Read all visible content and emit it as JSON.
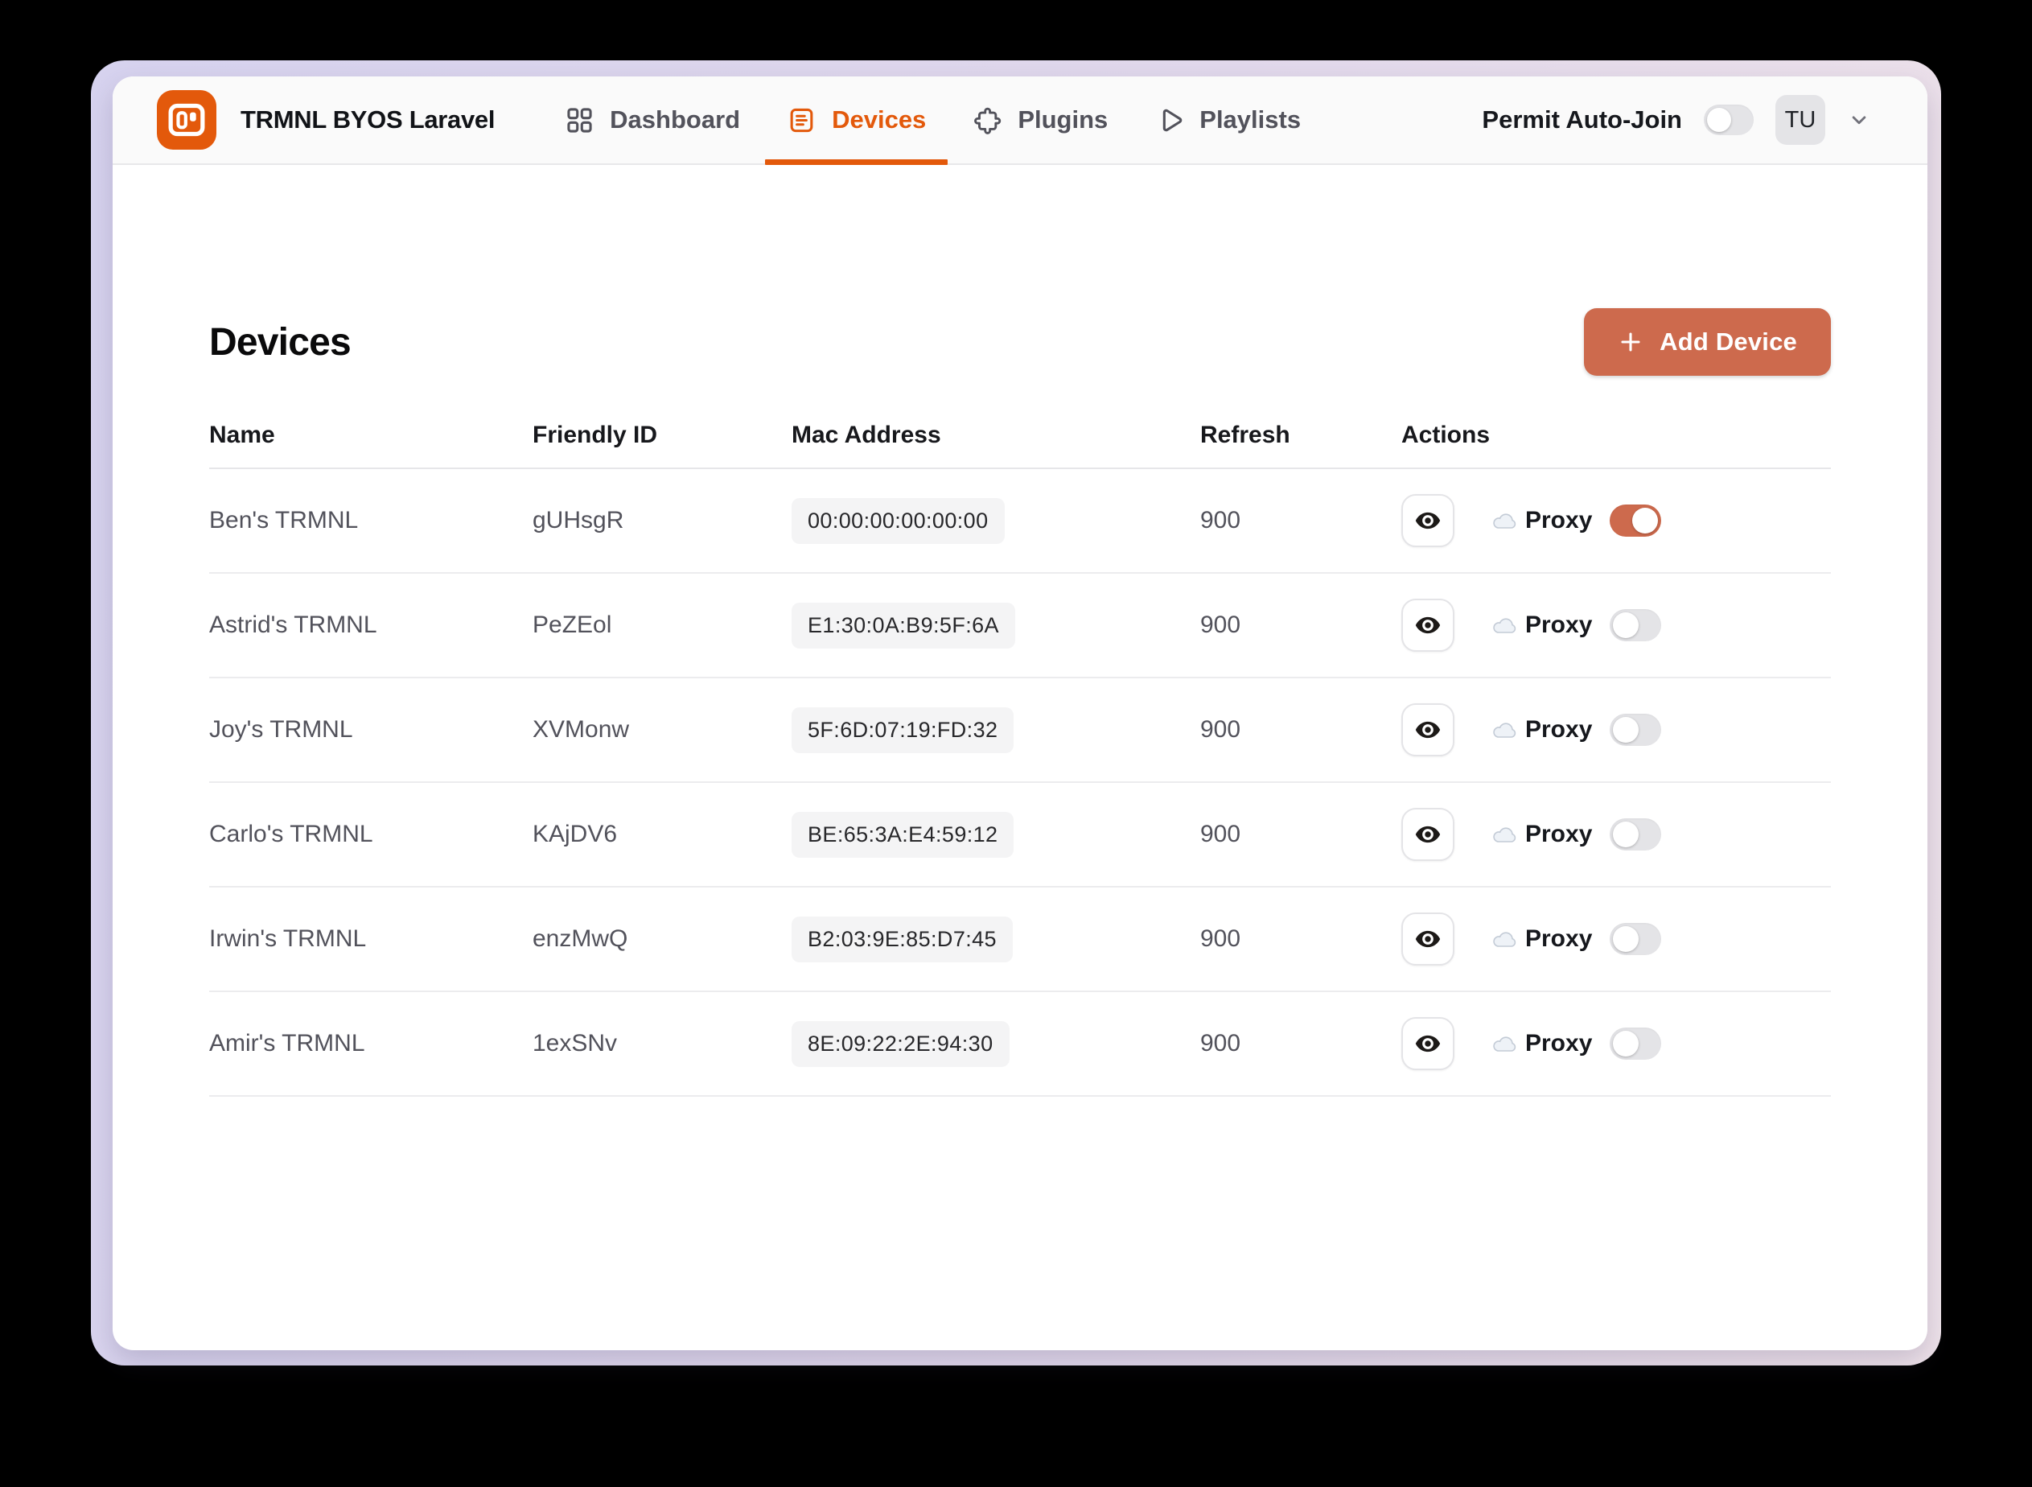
{
  "app": {
    "title": "TRMNL BYOS Laravel"
  },
  "nav": {
    "items": [
      {
        "label": "Dashboard",
        "icon": "grid-icon",
        "active": false
      },
      {
        "label": "Devices",
        "icon": "list-icon",
        "active": true
      },
      {
        "label": "Plugins",
        "icon": "puzzle-icon",
        "active": false
      },
      {
        "label": "Playlists",
        "icon": "play-icon",
        "active": false
      }
    ]
  },
  "header_right": {
    "auto_join_label": "Permit Auto-Join",
    "auto_join_on": false,
    "avatar_initials": "TU"
  },
  "page": {
    "title": "Devices",
    "add_button_label": "Add Device",
    "add_button_icon": "plus-icon"
  },
  "table": {
    "columns": [
      "Name",
      "Friendly ID",
      "Mac Address",
      "Refresh",
      "Actions"
    ],
    "proxy_label": "Proxy",
    "rows": [
      {
        "name": "Ben's TRMNL",
        "friendly_id": "gUHsgR",
        "mac": "00:00:00:00:00:00",
        "refresh": "900",
        "proxy_on": true
      },
      {
        "name": "Astrid's TRMNL",
        "friendly_id": "PeZEol",
        "mac": "E1:30:0A:B9:5F:6A",
        "refresh": "900",
        "proxy_on": false
      },
      {
        "name": "Joy's TRMNL",
        "friendly_id": "XVMonw",
        "mac": "5F:6D:07:19:FD:32",
        "refresh": "900",
        "proxy_on": false
      },
      {
        "name": "Carlo's TRMNL",
        "friendly_id": "KAjDV6",
        "mac": "BE:65:3A:E4:59:12",
        "refresh": "900",
        "proxy_on": false
      },
      {
        "name": "Irwin's TRMNL",
        "friendly_id": "enzMwQ",
        "mac": "B2:03:9E:85:D7:45",
        "refresh": "900",
        "proxy_on": false
      },
      {
        "name": "Amir's TRMNL",
        "friendly_id": "1exSNv",
        "mac": "8E:09:22:2E:94:30",
        "refresh": "900",
        "proxy_on": false
      }
    ]
  },
  "colors": {
    "accent_orange": "#E3590B",
    "terracotta_button": "#CD6A4D",
    "toggle_off_track": "#E4E4E7",
    "header_bar_bg": "#FAFAFA",
    "row_divider": "#ECECEE",
    "mac_pill_bg": "#F4F4F5",
    "frame_gradient_left": "#D7D3EF",
    "frame_gradient_right": "#EFE3EA",
    "desktop_bg": "#000000"
  }
}
